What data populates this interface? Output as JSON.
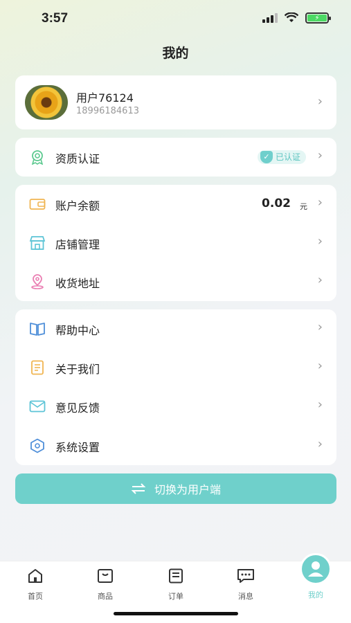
{
  "status_bar": {
    "time": "3:57"
  },
  "header": {
    "title": "我的"
  },
  "profile": {
    "name": "用户76124",
    "phone": "18996184613"
  },
  "certification": {
    "label": "资质认证",
    "badge": "已认证"
  },
  "account": {
    "items": [
      {
        "label": "账户余额",
        "value": "0.02",
        "unit": "元"
      },
      {
        "label": "店铺管理"
      },
      {
        "label": "收货地址"
      }
    ]
  },
  "settings": {
    "items": [
      {
        "label": "帮助中心"
      },
      {
        "label": "关于我们"
      },
      {
        "label": "意见反馈"
      },
      {
        "label": "系统设置"
      }
    ]
  },
  "switch_button": {
    "label": "切换为用户端"
  },
  "tabbar": {
    "tabs": [
      {
        "label": "首页"
      },
      {
        "label": "商品"
      },
      {
        "label": "订单"
      },
      {
        "label": "消息"
      },
      {
        "label": "我的"
      }
    ],
    "active": "我的"
  },
  "colors": {
    "accent": "#6fd0cb",
    "background": "#f2f3f5"
  }
}
